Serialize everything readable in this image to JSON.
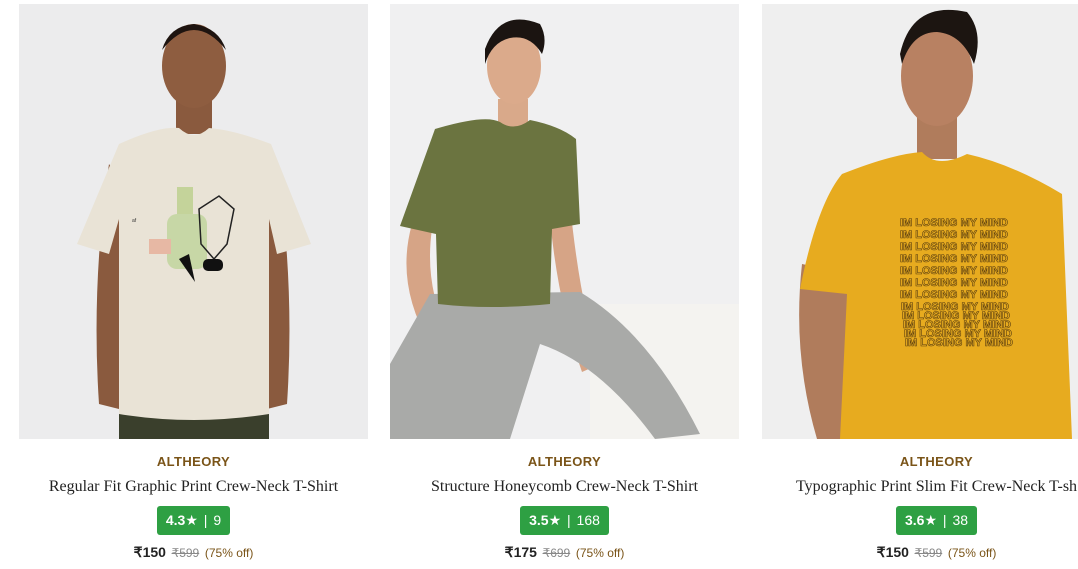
{
  "products": [
    {
      "brand": "ALTHEORY",
      "title": "Regular Fit Graphic Print Crew-Neck T-Shirt",
      "rating": "4.3",
      "star": "★",
      "reviews": "9",
      "price": "₹150",
      "mrp": "₹599",
      "discount": "(75% off)",
      "tshirt_color": "#e9e3d6"
    },
    {
      "brand": "ALTHEORY",
      "title": "Structure Honeycomb Crew-Neck T-Shirt",
      "rating": "3.5",
      "star": "★",
      "reviews": "168",
      "price": "₹175",
      "mrp": "₹699",
      "discount": "(75% off)",
      "tshirt_color": "#6b7440"
    },
    {
      "brand": "ALTHEORY",
      "title": "Typographic Print Slim Fit Crew-Neck T-sh",
      "rating": "3.6",
      "star": "★",
      "reviews": "38",
      "price": "₹150",
      "mrp": "₹599",
      "discount": "(75% off)",
      "tshirt_color": "#e7ab1f",
      "print_text": "IM LOSING MY MIND"
    }
  ],
  "separator": "|",
  "colors": {
    "rating_bg": "#2ea043",
    "brand": "#7a5418"
  }
}
